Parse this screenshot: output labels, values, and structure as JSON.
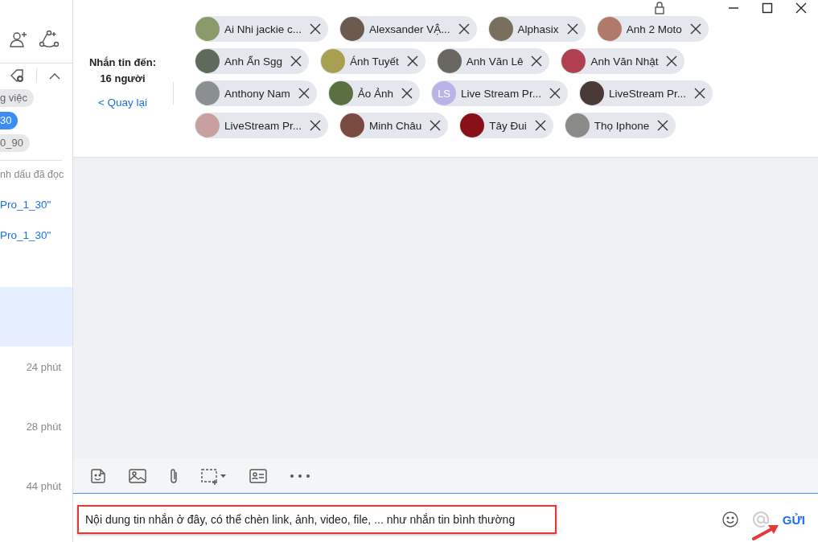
{
  "sidebar": {
    "tags": [
      {
        "label": "g việc",
        "selected": false
      },
      {
        "label": "30",
        "selected": true
      },
      {
        "label": "0_90",
        "selected": false
      }
    ],
    "mark_read": "nh dấu đã đọc",
    "previews": [
      "Pro_1_30\"",
      "Pro_1_30\""
    ],
    "conversations": [
      {
        "selected": true
      },
      {
        "time": "24 phút",
        "selected": false
      },
      {
        "time": "28 phút",
        "selected": false
      },
      {
        "time": "44 phút",
        "selected": false
      }
    ]
  },
  "header": {
    "recipients_label": "Nhắn tin đến:",
    "recipients_count": "16 người",
    "back_link": "< Quay lại"
  },
  "recipients": [
    {
      "name": "Ai Nhi jackie c...",
      "kind": "photo",
      "color": "#8a9a6a"
    },
    {
      "name": "Alexsander VẬ...",
      "kind": "photo",
      "color": "#6b5a4e"
    },
    {
      "name": "Alphasix",
      "kind": "photo",
      "color": "#7a6e5c"
    },
    {
      "name": "Anh 2 Moto",
      "kind": "photo",
      "color": "#b07a6a"
    },
    {
      "name": "Anh Ẩn Sgg",
      "kind": "photo",
      "color": "#5e6a5a"
    },
    {
      "name": "Ánh Tuyết",
      "kind": "photo",
      "color": "#a8a050"
    },
    {
      "name": "Anh Văn Lê",
      "kind": "photo",
      "color": "#6a6660"
    },
    {
      "name": "Anh Văn Nhật",
      "kind": "photo",
      "color": "#b04050"
    },
    {
      "name": "Anthony Nam",
      "kind": "photo",
      "color": "#8a9090"
    },
    {
      "name": "Ảo Ảnh",
      "kind": "photo",
      "color": "#5a7040"
    },
    {
      "name": "Live Stream Pr...",
      "kind": "initials",
      "initials": "LS",
      "color": "#b8b4e8"
    },
    {
      "name": "LiveStream Pr...",
      "kind": "photo",
      "color": "#4a3a36"
    },
    {
      "name": "LiveStream Pr...",
      "kind": "photo",
      "color": "#c8a0a0"
    },
    {
      "name": "Minh Châu",
      "kind": "photo",
      "color": "#7a4a40"
    },
    {
      "name": "Tây Đui",
      "kind": "photo",
      "color": "#8a1018"
    },
    {
      "name": "Thọ Iphone",
      "kind": "photo",
      "color": "#8a8a88"
    }
  ],
  "composer": {
    "message": "Nội dung tin nhắn ở đây, có thể chèn link, ảnh, video, file, ... như nhắn tin bình thường",
    "send": "GỬI"
  }
}
